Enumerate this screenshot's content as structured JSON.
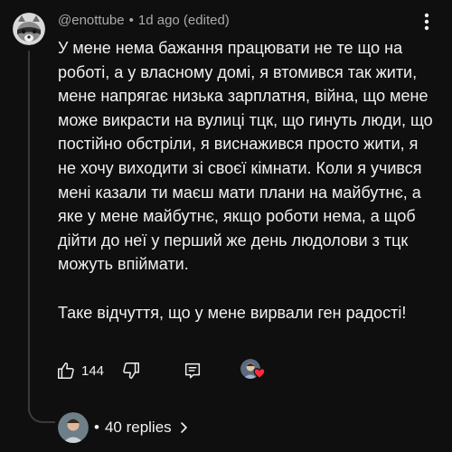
{
  "comment": {
    "author": "@enottube",
    "separator": "•",
    "time": "1d ago (edited)",
    "paragraphs": [
      "У мене нема бажання працювати не те що на роботі, а у власному домі, я втомився так жити, мене напрягає низька зарплатня, війна, що мене може викрасти на вулиці тцк, що гинуть люди, що постійно обстріли, я виснажився просто жити, я не хочу виходити зі своєї кімнати. Коли я учився мені казали ти маєш мати плани на майбутнє, а яке у мене майбутнє, якщо роботи нема, а щоб дійти до неї у перший же день людолови з тцк можуть впіймати.",
      "Таке відчуття, що у мене вирвали ген радості!"
    ]
  },
  "actions": {
    "like_count": "144",
    "icons": [
      "thumbs-up-icon",
      "thumbs-down-icon",
      "reply-icon",
      "creator-heart-icon"
    ]
  },
  "replies": {
    "separator": "•",
    "label": "40 replies",
    "icon": "chevron-right-icon"
  },
  "colors": {
    "background": "#0f0f0f",
    "text": "#f1f1f1",
    "meta": "#aaaaaa",
    "thread": "#3a3a3a",
    "heart": "#ff2a3d"
  }
}
